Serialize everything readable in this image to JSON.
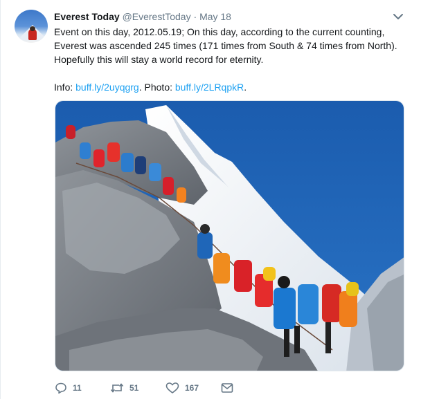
{
  "tweet": {
    "author_name": "Everest Today",
    "handle": "@EverestToday",
    "separator": "·",
    "date": "May 18",
    "body_line1": "Event on this day, 2012.05.19; On this day, according to the current counting,",
    "body_line2": "Everest was ascended 245 times (171 times from South & 74 times from North).",
    "body_line3": "Hopefully this will stay a world record for eternity.",
    "info_prefix": "Info: ",
    "info_link": "buff.ly/2uyqgrg",
    "photo_prefix": ". Photo: ",
    "photo_link": "buff.ly/2LRqpkR",
    "photo_suffix": "."
  },
  "actions": {
    "replies": "11",
    "retweets": "51",
    "likes": "167"
  },
  "icons": {
    "reply": "reply-icon",
    "retweet": "retweet-icon",
    "like": "heart-icon",
    "message": "direct-message-icon",
    "menu": "chevron-down-icon"
  },
  "colors": {
    "link": "#1da1f2",
    "muted": "#657786",
    "sky": "#1e63b5"
  }
}
